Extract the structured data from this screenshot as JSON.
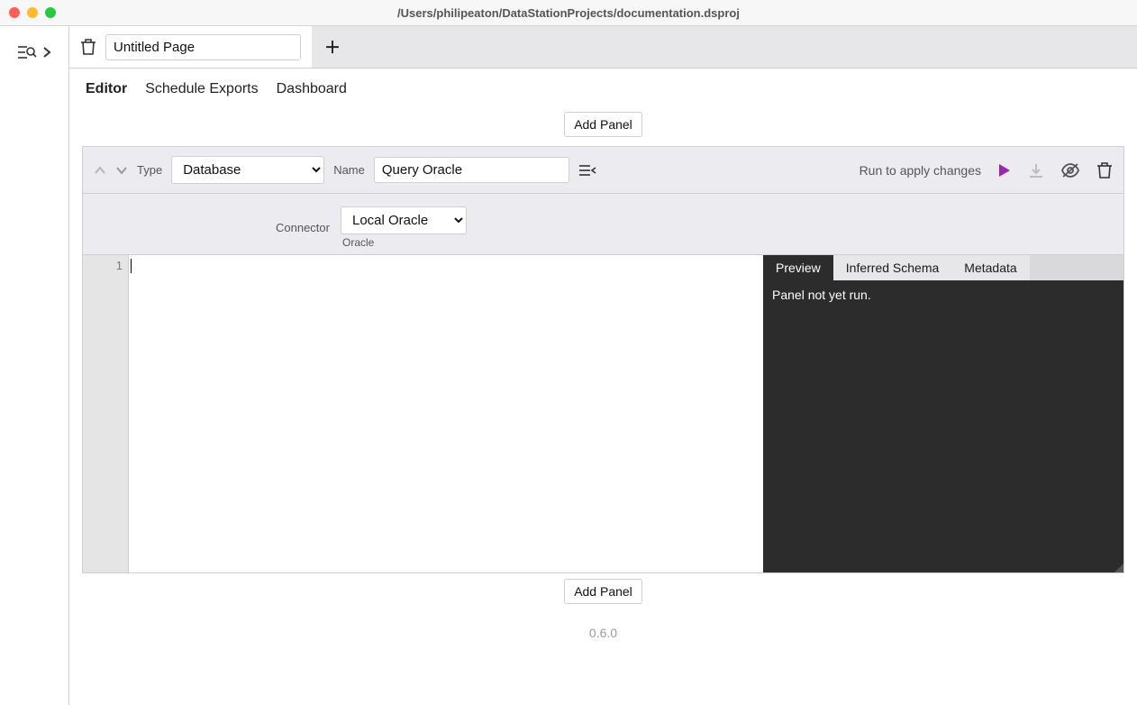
{
  "window": {
    "title": "/Users/philipeaton/DataStationProjects/documentation.dsproj"
  },
  "tabs": {
    "page_name": "Untitled Page"
  },
  "nav": {
    "editor": "Editor",
    "schedule": "Schedule Exports",
    "dashboard": "Dashboard"
  },
  "buttons": {
    "add_panel": "Add Panel"
  },
  "panel": {
    "type_label": "Type",
    "type_value": "Database",
    "name_label": "Name",
    "name_value": "Query Oracle",
    "run_hint": "Run to apply changes",
    "connector_label": "Connector",
    "connector_value": "Local Oracle",
    "connector_kind": "Oracle"
  },
  "editor": {
    "first_line_no": "1"
  },
  "preview": {
    "tab_preview": "Preview",
    "tab_schema": "Inferred Schema",
    "tab_meta": "Metadata",
    "message": "Panel not yet run."
  },
  "footer": {
    "version": "0.6.0"
  }
}
